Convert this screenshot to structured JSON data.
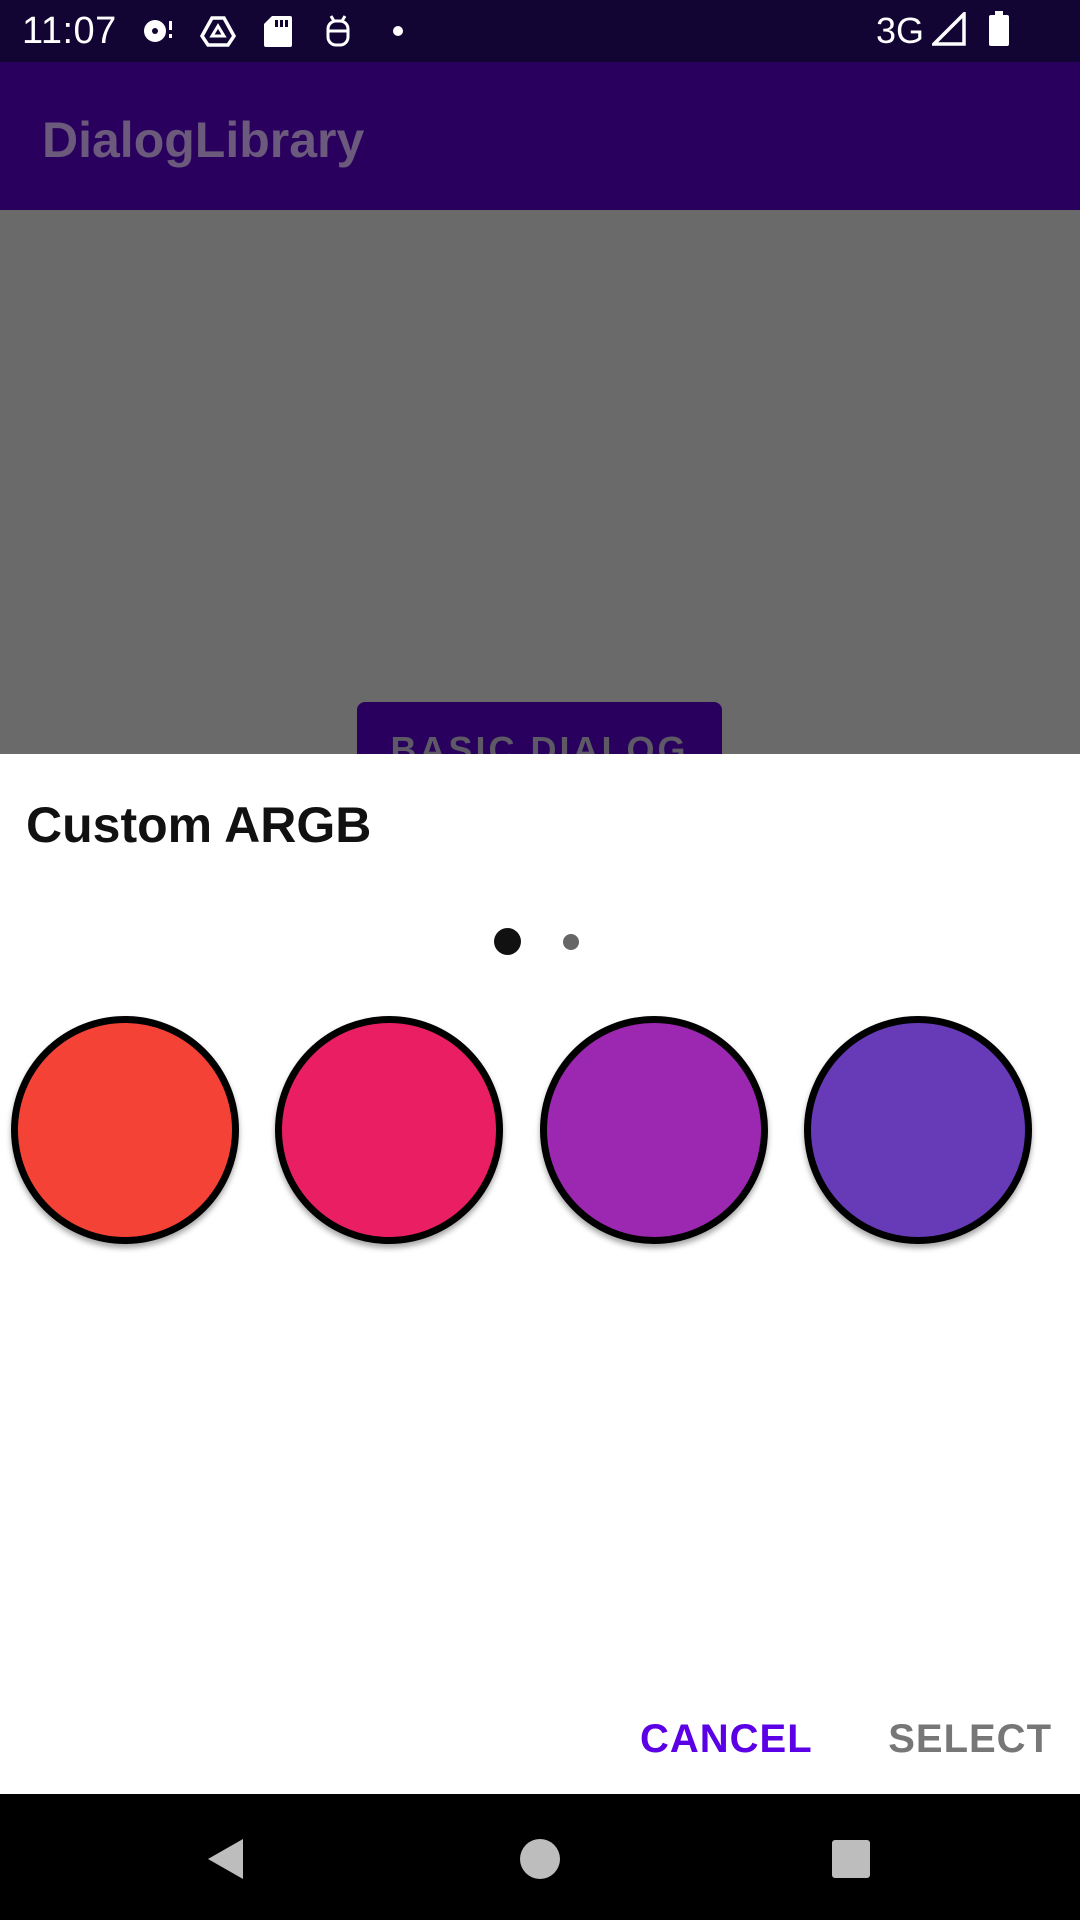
{
  "status_bar": {
    "time": "11:07",
    "network": "3G",
    "icons_left": [
      "media-icon",
      "drive-icon",
      "sd-card-icon",
      "debug-icon",
      "dot-icon"
    ],
    "icons_right": [
      "signal-icon",
      "battery-icon"
    ]
  },
  "app_bar": {
    "title": "DialogLibrary"
  },
  "background": {
    "button_label": "BASIC DIALOG"
  },
  "dialog": {
    "title": "Custom ARGB",
    "page_indicator": {
      "pages": 2,
      "active": 0
    },
    "swatches": [
      {
        "name": "red",
        "color": "#f44336"
      },
      {
        "name": "pink",
        "color": "#e91e63"
      },
      {
        "name": "purple",
        "color": "#9c27b0"
      },
      {
        "name": "deep-purple",
        "color": "#673ab7"
      }
    ],
    "cancel_label": "CANCEL",
    "select_label": "SELECT"
  },
  "colors": {
    "status_bar": "#130533",
    "app_bar": "#2a005e",
    "scrim": "#6a6a6a",
    "accent": "#5b00e6"
  },
  "nav_bar": {
    "buttons": [
      "back-icon",
      "home-icon",
      "recents-icon"
    ]
  }
}
